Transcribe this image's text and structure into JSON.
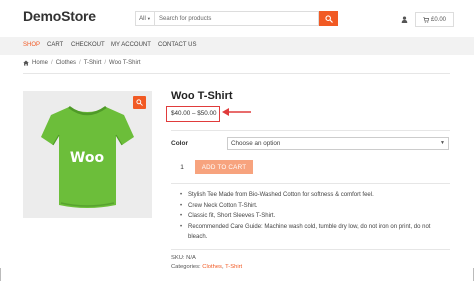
{
  "header": {
    "logo": "DemoStore",
    "search": {
      "category": "All",
      "placeholder": "Search for products"
    },
    "cart_amount": "£0.00",
    "icons": {
      "search_button": "search-icon",
      "user": "user-icon",
      "cart": "cart-icon"
    }
  },
  "nav": {
    "items": [
      {
        "label": "SHOP",
        "active": true
      },
      {
        "label": "CART",
        "active": false
      },
      {
        "label": "CHECKOUT",
        "active": false
      },
      {
        "label": "MY ACCOUNT",
        "active": false
      },
      {
        "label": "CONTACT US",
        "active": false
      }
    ]
  },
  "breadcrumb": {
    "home": "Home",
    "items": [
      "Clothes",
      "T-Shirt",
      "Woo T-Shirt"
    ],
    "separator": "/"
  },
  "product": {
    "title": "Woo T-Shirt",
    "price": "$40.00 – $50.00",
    "image_text": "Woo",
    "color_label": "Color",
    "color_select": "Choose an option",
    "quantity": "1",
    "add_to_cart": "ADD TO CART",
    "description": [
      "Stylish Tee Made from Bio-Washed Cotton for softness & comfort feel.",
      "Crew Neck Cotton T-Shirt.",
      "Classic fit, Short Sleeves T-Shirt.",
      "Recommended Care Guide: Machine wash cold, tumble dry low, do not iron on print, do not bleach."
    ],
    "sku_label": "SKU:",
    "sku": "N/A",
    "categories_label": "Categories:",
    "category_1": "Clothes",
    "category_separator": ",",
    "category_2": "T-Shirt"
  },
  "colors": {
    "accent": "#f15a24",
    "add_to_cart": "#f7a37e",
    "highlight": "#e03b3b",
    "shirt": "#6cbe3a",
    "nav_bg": "#f2f2f2"
  }
}
